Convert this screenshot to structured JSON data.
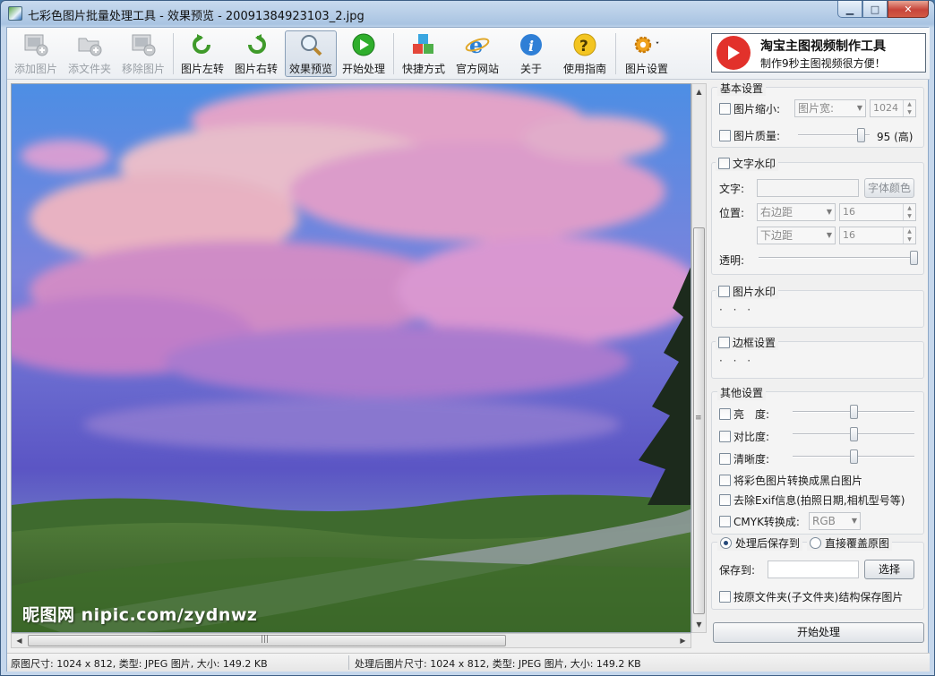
{
  "window": {
    "title": "七彩色图片批量处理工具 - 效果预览 - 20091384923103_2.jpg",
    "min_label": "▁",
    "max_label": "□",
    "close_label": "✕"
  },
  "toolbar": {
    "items": [
      {
        "label": "添加图片",
        "icon": "add-image-icon",
        "enabled": false
      },
      {
        "label": "添文件夹",
        "icon": "add-folder-icon",
        "enabled": false
      },
      {
        "label": "移除图片",
        "icon": "remove-image-icon",
        "enabled": false
      },
      {
        "label": "图片左转",
        "icon": "rotate-left-icon",
        "enabled": true
      },
      {
        "label": "图片右转",
        "icon": "rotate-right-icon",
        "enabled": true
      },
      {
        "label": "效果预览",
        "icon": "magnifier-icon",
        "enabled": true,
        "active": true
      },
      {
        "label": "开始处理",
        "icon": "play-icon",
        "enabled": true
      },
      {
        "label": "快捷方式",
        "icon": "shortcut-cubes-icon",
        "enabled": true
      },
      {
        "label": "官方网站",
        "icon": "ie-browser-icon",
        "enabled": true
      },
      {
        "label": "关于",
        "icon": "info-icon",
        "enabled": true
      },
      {
        "label": "使用指南",
        "icon": "help-icon",
        "enabled": true
      },
      {
        "label": "图片设置",
        "icon": "gear-icon",
        "enabled": true
      }
    ]
  },
  "promo": {
    "title": "淘宝主图视频制作工具",
    "subtitle": "制作9秒主图视频很方便！"
  },
  "preview": {
    "watermark": "昵图网 nipic.com/zydnwz",
    "scroll_grip": "≡",
    "hscroll_grip": "|||"
  },
  "basic": {
    "title": "基本设置",
    "resize_label": "图片缩小:",
    "resize_mode": "图片宽:",
    "resize_value": "1024",
    "quality_label": "图片质量:",
    "quality_value": "95 (高)",
    "quality_level": 0.93
  },
  "text_wm": {
    "title": "文字水印",
    "text_label": "文字:",
    "font_color_button": "字体颜色",
    "position_label": "位置:",
    "h_anchor": "右边距",
    "h_value": "16",
    "v_anchor": "下边距",
    "v_value": "16",
    "opacity_label": "透明:",
    "opacity_level": 1.0
  },
  "image_wm": {
    "title": "图片水印",
    "dots": "· · ·"
  },
  "border": {
    "title": "边框设置",
    "dots": "· · ·"
  },
  "other": {
    "title": "其他设置",
    "brightness_label": "亮　度:",
    "brightness_level": 0.5,
    "contrast_label": "对比度:",
    "contrast_level": 0.5,
    "sharpness_label": "清晰度:",
    "sharpness_level": 0.5,
    "grayscale_label": "将彩色图片转换成黑白图片",
    "exif_label": "去除Exif信息(拍照日期,相机型号等)",
    "cmyk_label": "CMYK转换成:",
    "cmyk_value": "RGB"
  },
  "save": {
    "save_to_radio": "处理后保存到",
    "overwrite_radio": "直接覆盖原图",
    "save_to_label": "保存到:",
    "choose_button": "选择",
    "keep_structure_label": "按原文件夹(子文件夹)结构保存图片",
    "start_button": "开始处理"
  },
  "status": {
    "original": "原图尺寸: 1024 x 812, 类型: JPEG 图片, 大小: 149.2 KB",
    "processed": "处理后图片尺寸: 1024 x 812, 类型: JPEG 图片, 大小: 149.2 KB"
  },
  "colors": {
    "accent_blue": "#2f6fbb",
    "promo_red": "#e2312b",
    "sky_top": "#4d8ee4",
    "cloud_pink": "#f2a6c6"
  }
}
